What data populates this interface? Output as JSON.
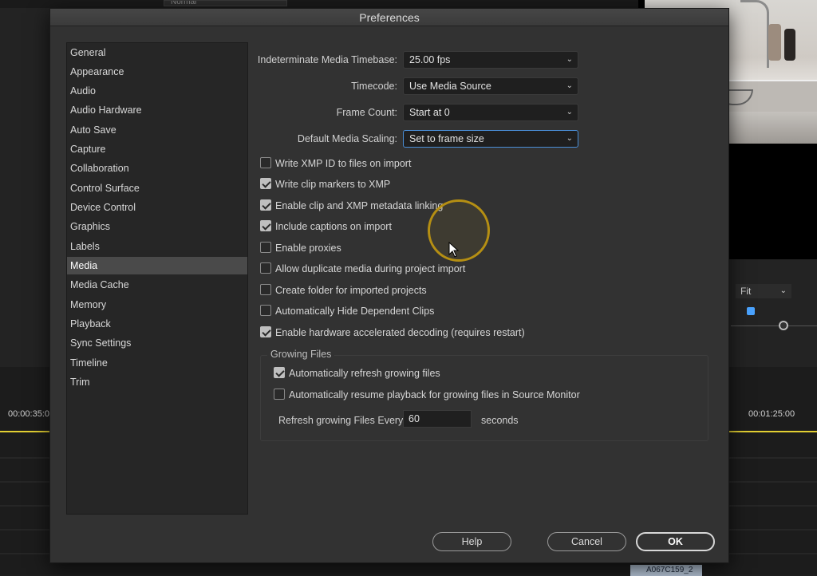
{
  "background": {
    "top_field": "Normal",
    "fit_select": "Fit",
    "timecode_left": "00:00:35:0",
    "timecode_right": "00:01:25:00",
    "clip_label": "A067C159_2",
    "colors": {
      "playhead_line": "#e2cf32",
      "marker": "#4aa3ff"
    }
  },
  "dialog": {
    "title": "Preferences",
    "sidebar": {
      "selected": "Media",
      "items": [
        "General",
        "Appearance",
        "Audio",
        "Audio Hardware",
        "Auto Save",
        "Capture",
        "Collaboration",
        "Control Surface",
        "Device Control",
        "Graphics",
        "Labels",
        "Media",
        "Media Cache",
        "Memory",
        "Playback",
        "Sync Settings",
        "Timeline",
        "Trim"
      ]
    },
    "fields": [
      {
        "label": "Indeterminate Media Timebase:",
        "value": "25.00 fps"
      },
      {
        "label": "Timecode:",
        "value": "Use Media Source"
      },
      {
        "label": "Frame Count:",
        "value": "Start at 0"
      },
      {
        "label": "Default Media Scaling:",
        "value": "Set to frame size"
      }
    ],
    "checkboxes": [
      {
        "label": "Write XMP ID to files on import",
        "checked": false
      },
      {
        "label": "Write clip markers to XMP",
        "checked": true
      },
      {
        "label": "Enable clip and XMP metadata linking",
        "checked": true
      },
      {
        "label": "Include captions on import",
        "checked": true
      },
      {
        "label": "Enable proxies",
        "checked": false
      },
      {
        "label": "Allow duplicate media during project import",
        "checked": false
      },
      {
        "label": "Create folder for imported projects",
        "checked": false
      },
      {
        "label": "Automatically Hide Dependent Clips",
        "checked": false
      },
      {
        "label": "Enable hardware accelerated decoding (requires restart)",
        "checked": true
      }
    ],
    "growing_files": {
      "title": "Growing Files",
      "checkboxes": [
        {
          "label": "Automatically refresh growing files",
          "checked": true
        },
        {
          "label": "Automatically resume playback for growing files in Source Monitor",
          "checked": false
        }
      ],
      "refresh_label": "Refresh growing Files Every",
      "refresh_value": "60",
      "refresh_unit": "seconds"
    },
    "buttons": {
      "help": "Help",
      "cancel": "Cancel",
      "ok": "OK"
    }
  }
}
